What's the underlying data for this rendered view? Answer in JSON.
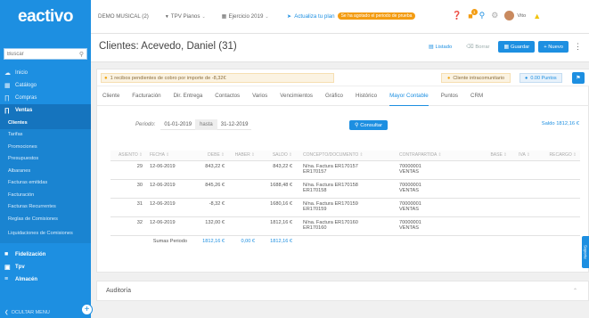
{
  "brand": {
    "logo_text": "eactivo"
  },
  "sidebar": {
    "search_placeholder": "Buscar",
    "items_top": [
      {
        "label": "Inicio",
        "icon": "cloud-icon"
      },
      {
        "label": "Catálogo",
        "icon": "box-icon"
      },
      {
        "label": "Compras",
        "icon": "cart-icon"
      },
      {
        "label": "Ventas",
        "icon": "tag-icon"
      }
    ],
    "ventas_sub": [
      "Clientes",
      "Tarifas",
      "Promociones",
      "Presupuestos",
      "Albaranes",
      "Facturas emitidas",
      "Facturación",
      "Facturas Recurrentes",
      "Reglas de Comisiones",
      "Liquidaciones de Comisiones"
    ],
    "items_bottom": [
      {
        "label": "Fidelización",
        "icon": "gift-icon"
      },
      {
        "label": "Tpv",
        "icon": "pos-icon"
      },
      {
        "label": "Almacén",
        "icon": "warehouse-icon"
      }
    ],
    "hide_menu": "OCULTAR MENU"
  },
  "topbar": {
    "company": "DEMO MUSICAL (2)",
    "terminal": "TPV Pianos",
    "year": "Ejercicio 2019",
    "upgrade_label": "Actualiza tu plan",
    "trial_pill": "Se ha agotado el periodo de prueba",
    "notif_count": "1",
    "user_name": "Vito"
  },
  "header": {
    "title": "Clientes: Acevedo, Daniel (31)",
    "btn_list": "Listado",
    "btn_delete": "Borrar",
    "btn_save": "Guardar",
    "btn_new": "+ Nuevo"
  },
  "alerts": {
    "pending": "1 recibos pendientes de cobro por importe de -8,32€",
    "intra": "Cliente intracomunitario",
    "points": "0.00 Puntos"
  },
  "tabs": [
    "Cliente",
    "Facturación",
    "Dir. Entrega",
    "Contactos",
    "Varios",
    "Vencimientos",
    "Gráfico",
    "Histórico",
    "Mayor Contable",
    "Puntos",
    "CRM"
  ],
  "active_tab": "Mayor Contable",
  "filter": {
    "period_label": "Periodo:",
    "from": "01-01-2019",
    "to_label": "hasta",
    "to": "31-12-2019",
    "consult": "Consultar",
    "saldo_top": "Saldo 1812,16 €"
  },
  "table": {
    "headers": [
      "ASIENTO",
      "FECHA",
      "DEBE",
      "HABER",
      "SALDO",
      "CONCEPTO/DOCUMENTO",
      "CONTRAPARTIDA",
      "BASE",
      "IVA",
      "RECARGO"
    ],
    "rows": [
      {
        "asiento": "29",
        "fecha": "12-06-2019",
        "debe": "843,22 €",
        "haber": "",
        "saldo": "843,22 €",
        "concepto_1": "N/na. Factura ER170157",
        "concepto_2": "ER170157",
        "contra_1": "70000001",
        "contra_2": "VENTAS"
      },
      {
        "asiento": "30",
        "fecha": "12-06-2019",
        "debe": "845,26 €",
        "haber": "",
        "saldo": "1688,48 €",
        "concepto_1": "N/na. Factura ER170158",
        "concepto_2": "ER170158",
        "contra_1": "70000001",
        "contra_2": "VENTAS"
      },
      {
        "asiento": "31",
        "fecha": "12-06-2019",
        "debe": "-8,32 €",
        "haber": "",
        "saldo": "1680,16 €",
        "concepto_1": "N/na. Factura ER170159",
        "concepto_2": "ER170159",
        "contra_1": "70000001",
        "contra_2": "VENTAS"
      },
      {
        "asiento": "32",
        "fecha": "12-06-2019",
        "debe": "132,00 €",
        "haber": "",
        "saldo": "1812,16 €",
        "concepto_1": "N/na. Factura ER170160",
        "concepto_2": "ER170160",
        "contra_1": "70000001",
        "contra_2": "VENTAS"
      }
    ],
    "sum_label": "Sumas Periodo",
    "sum_debe": "1812,16 €",
    "sum_haber": "0,00 €",
    "sum_saldo": "1812,16 €"
  },
  "audit_label": "Auditoría",
  "help_tab": "Soporte",
  "colors": {
    "primary": "#1d8fe1",
    "sidebar": "#1d8fe1",
    "warning": "#f39c12"
  }
}
